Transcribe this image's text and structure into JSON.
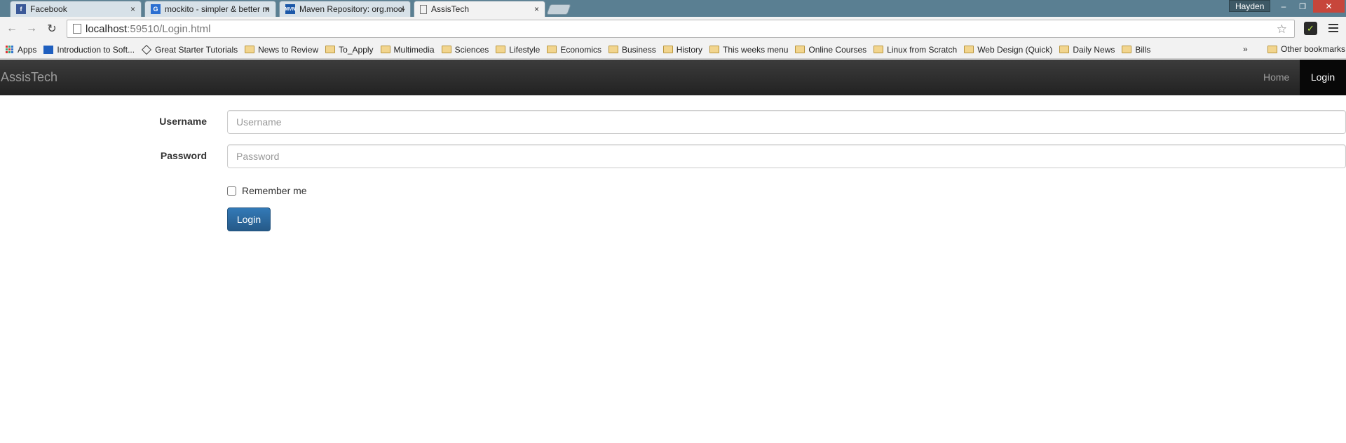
{
  "browser": {
    "tabs": [
      {
        "title": "Facebook",
        "favicon": "facebook-icon",
        "color": "#3b5998"
      },
      {
        "title": "mockito - simpler & better mocking",
        "favicon": "google-code-icon",
        "color": "#2b6fd1"
      },
      {
        "title": "Maven Repository: org.mockito",
        "favicon": "mvn-icon",
        "color": "#1c58a8"
      },
      {
        "title": "AssisTech",
        "favicon": "page-icon",
        "active": true
      }
    ],
    "close_glyph": "×",
    "profile_name": "Hayden",
    "window_controls": {
      "minimize": "–",
      "restore": "❐",
      "close": "✕"
    },
    "address": {
      "host": "localhost",
      "rest": ":59510/Login.html"
    },
    "nav": {
      "back": "←",
      "forward": "→",
      "reload": "↻"
    },
    "star_glyph": "☆",
    "extension_glyph": "✓",
    "bookmarks": [
      {
        "label": "Apps",
        "icon": "apps-icon"
      },
      {
        "label": "Introduction to Soft...",
        "icon": "blue-icon"
      },
      {
        "label": "Great Starter Tutorials",
        "icon": "diamond-icon"
      },
      {
        "label": "News to Review",
        "icon": "folder-icon"
      },
      {
        "label": "To_Apply",
        "icon": "folder-icon"
      },
      {
        "label": "Multimedia",
        "icon": "folder-icon"
      },
      {
        "label": "Sciences",
        "icon": "folder-icon"
      },
      {
        "label": "Lifestyle",
        "icon": "folder-icon"
      },
      {
        "label": "Economics",
        "icon": "folder-icon"
      },
      {
        "label": "Business",
        "icon": "folder-icon"
      },
      {
        "label": "History",
        "icon": "folder-icon"
      },
      {
        "label": "This weeks menu",
        "icon": "folder-icon"
      },
      {
        "label": "Online Courses",
        "icon": "folder-icon"
      },
      {
        "label": "Linux from Scratch",
        "icon": "folder-icon"
      },
      {
        "label": "Web Design (Quick)",
        "icon": "folder-icon"
      },
      {
        "label": "Daily News",
        "icon": "folder-icon"
      },
      {
        "label": "Bills",
        "icon": "folder-icon"
      }
    ],
    "overflow_glyph": "»",
    "other_bookmarks": "Other bookmarks"
  },
  "site": {
    "brand": "AssisTech",
    "nav": {
      "home": "Home",
      "login": "Login"
    }
  },
  "form": {
    "username_label": "Username",
    "username_placeholder": "Username",
    "password_label": "Password",
    "password_placeholder": "Password",
    "remember_label": "Remember me",
    "submit_label": "Login"
  }
}
